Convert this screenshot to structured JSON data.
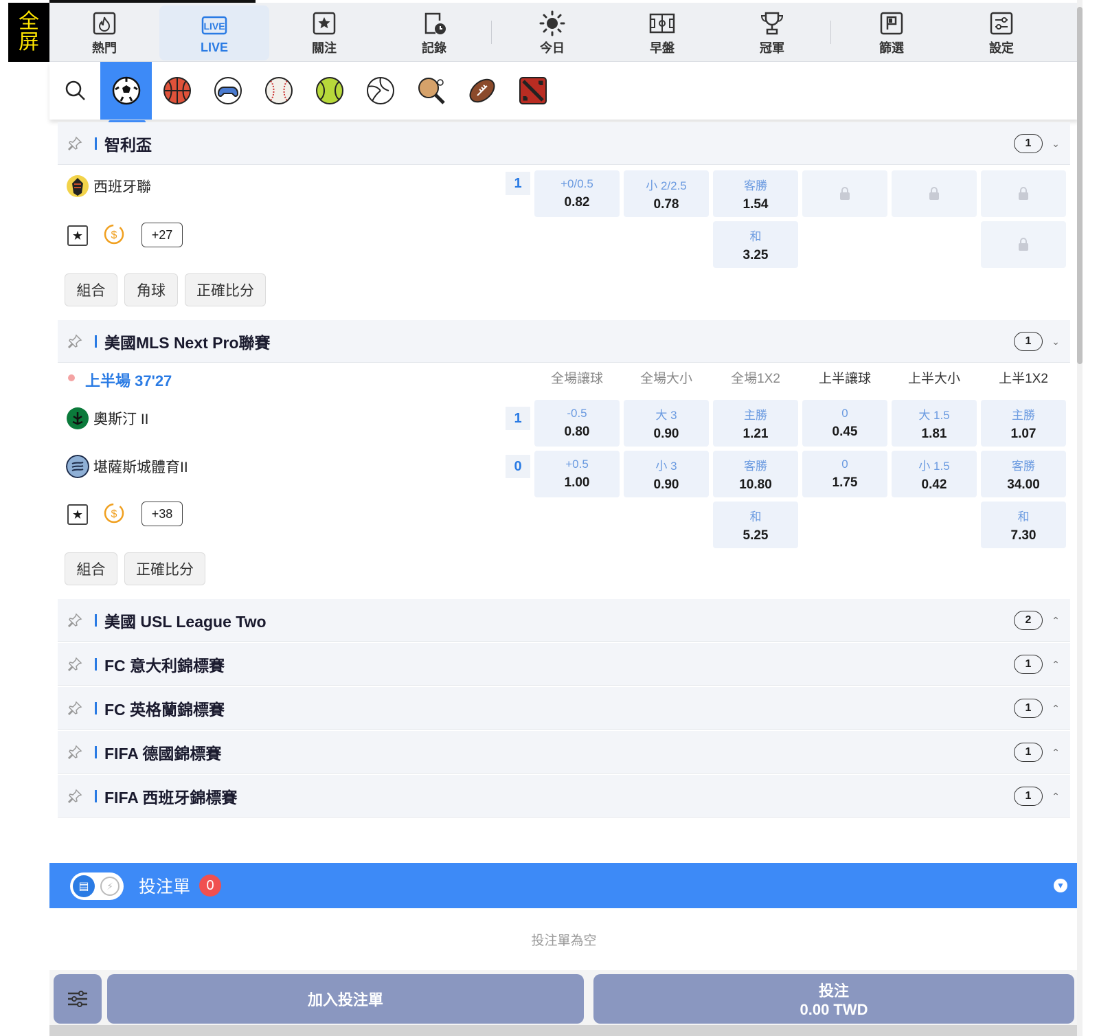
{
  "fullscreen": {
    "line1": "全",
    "line2": "屏"
  },
  "nav": [
    {
      "label": "熱門",
      "icon": "flame-icon"
    },
    {
      "label": "LIVE",
      "icon": "live-icon",
      "active": true
    },
    {
      "label": "關注",
      "icon": "star-icon"
    },
    {
      "label": "記錄",
      "icon": "history-icon"
    },
    {
      "label": "今日",
      "icon": "sun-icon"
    },
    {
      "label": "早盤",
      "icon": "pitch-icon"
    },
    {
      "label": "冠軍",
      "icon": "trophy-icon"
    },
    {
      "label": "篩選",
      "icon": "filter-icon"
    },
    {
      "label": "設定",
      "icon": "settings-icon"
    }
  ],
  "live_text": "LIVE",
  "sports": [
    "search-icon",
    "soccer-icon",
    "basketball-icon",
    "esports-icon",
    "baseball-icon",
    "tennis-icon",
    "volleyball-icon",
    "table-tennis-icon",
    "american-football-icon",
    "dota-icon"
  ],
  "leagues": {
    "chile": {
      "name": "智利盃",
      "count": "1"
    },
    "mls": {
      "name": "美國MLS Next Pro聯賽",
      "count": "1"
    },
    "usl": {
      "name": "美國 USL League Two",
      "count": "2"
    },
    "fc_italy": {
      "name": "FC 意大利錦標賽",
      "count": "1"
    },
    "fc_england": {
      "name": "FC 英格蘭錦標賽",
      "count": "1"
    },
    "fifa_germany": {
      "name": "FIFA 德國錦標賽",
      "count": "1"
    },
    "fifa_spain": {
      "name": "FIFA 西班牙錦標賽",
      "count": "1"
    }
  },
  "match1": {
    "team": "西班牙聯",
    "score": "1",
    "more": "+27",
    "odds": [
      {
        "label": "+0/0.5",
        "value": "0.82"
      },
      {
        "label": "小 2/2.5",
        "value": "0.78"
      },
      {
        "label": "客勝",
        "value": "1.54"
      }
    ],
    "draw": {
      "label": "和",
      "value": "3.25"
    },
    "tags": [
      "組合",
      "角球",
      "正確比分"
    ]
  },
  "match2": {
    "period": "上半場 37'27",
    "columns": [
      "全場讓球",
      "全場大小",
      "全場1X2",
      "上半讓球",
      "上半大小",
      "上半1X2"
    ],
    "home": {
      "team": "奧斯汀 II",
      "score": "1"
    },
    "away": {
      "team": "堪薩斯城體育II",
      "score": "0"
    },
    "more": "+38",
    "home_odds": [
      {
        "label": "-0.5",
        "value": "0.80"
      },
      {
        "label": "大 3",
        "value": "0.90"
      },
      {
        "label": "主勝",
        "value": "1.21"
      },
      {
        "label": "0",
        "value": "0.45"
      },
      {
        "label": "大 1.5",
        "value": "1.81"
      },
      {
        "label": "主勝",
        "value": "1.07"
      }
    ],
    "away_odds": [
      {
        "label": "+0.5",
        "value": "1.00"
      },
      {
        "label": "小 3",
        "value": "0.90"
      },
      {
        "label": "客勝",
        "value": "10.80"
      },
      {
        "label": "0",
        "value": "1.75"
      },
      {
        "label": "小 1.5",
        "value": "0.42"
      },
      {
        "label": "客勝",
        "value": "34.00"
      }
    ],
    "draw_full": {
      "label": "和",
      "value": "5.25"
    },
    "draw_half": {
      "label": "和",
      "value": "7.30"
    },
    "tags": [
      "組合",
      "正確比分"
    ]
  },
  "betslip": {
    "title": "投注單",
    "count": "0",
    "empty": "投注單為空",
    "add_button": "加入投注單",
    "bet_button": "投注",
    "amount": "0.00 TWD"
  },
  "colors": {
    "accent": "#3d8af7",
    "live": "#2a7be4",
    "badge": "#f05050",
    "button": "#8a97c0"
  }
}
